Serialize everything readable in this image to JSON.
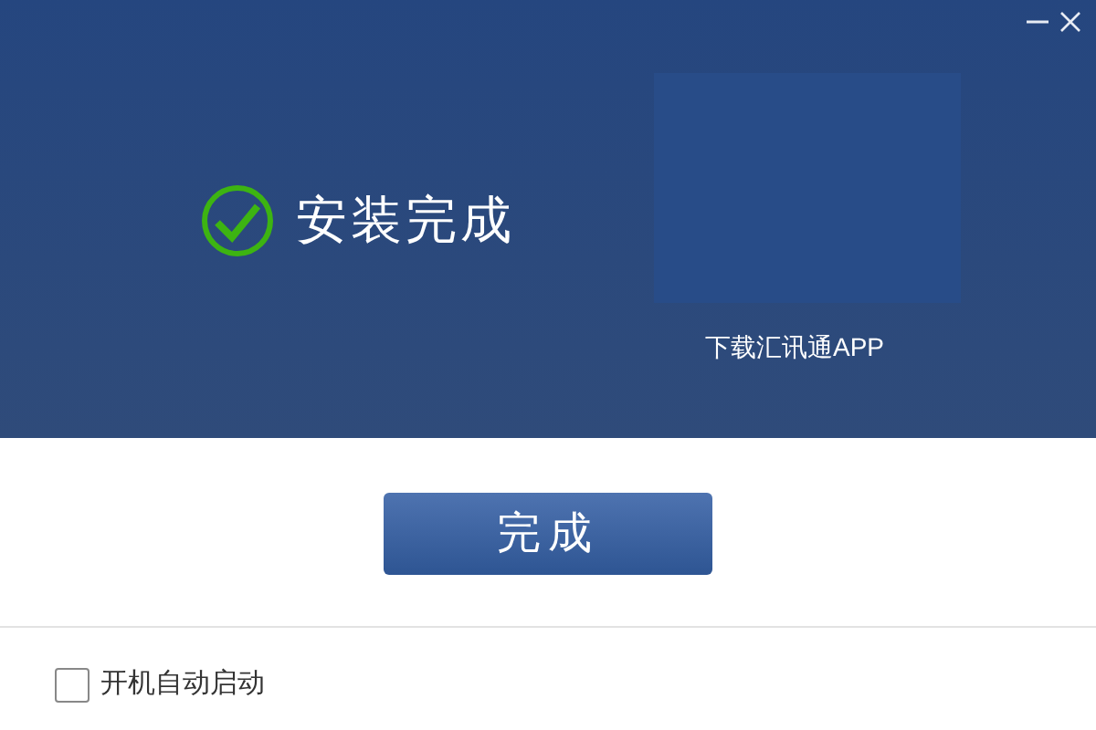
{
  "header": {
    "title": "安装完成",
    "app_download_label": "下载汇讯通APP"
  },
  "finish_button": {
    "label": "完成"
  },
  "autostart": {
    "label": "开机自动启动",
    "checked": false
  }
}
